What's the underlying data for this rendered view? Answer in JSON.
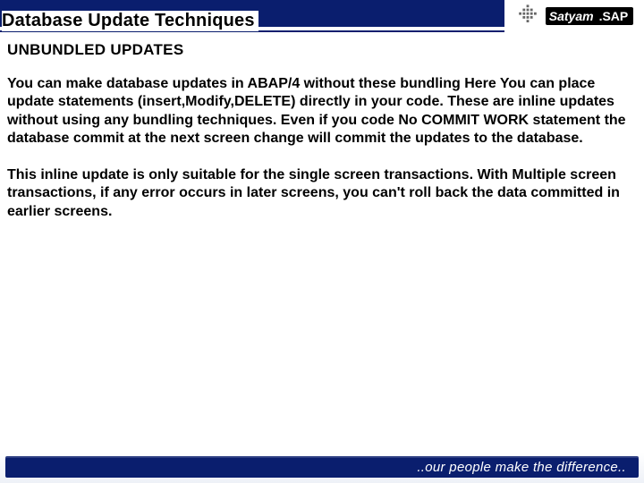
{
  "header": {
    "title": "Database Update Techniques",
    "brand_satyam": "Satyam",
    "brand_sap": "SAP"
  },
  "content": {
    "subheading": "UNBUNDLED UPDATES",
    "para1": "You can make database updates in ABAP/4 without these bundling  Here You can place update statements (insert,Modify,DELETE) directly in your code. These are inline updates without using any bundling techniques. Even if you code  No COMMIT WORK statement the database commit at the next screen change will commit the updates to the database.",
    "para2": "This inline update is only suitable for the single screen transactions. With Multiple screen transactions, if any error occurs in later screens, you can't roll back the data committed in earlier screens."
  },
  "footer": {
    "tagline": "..our people make the difference.."
  },
  "colors": {
    "brand_blue": "#0a1e6e"
  }
}
